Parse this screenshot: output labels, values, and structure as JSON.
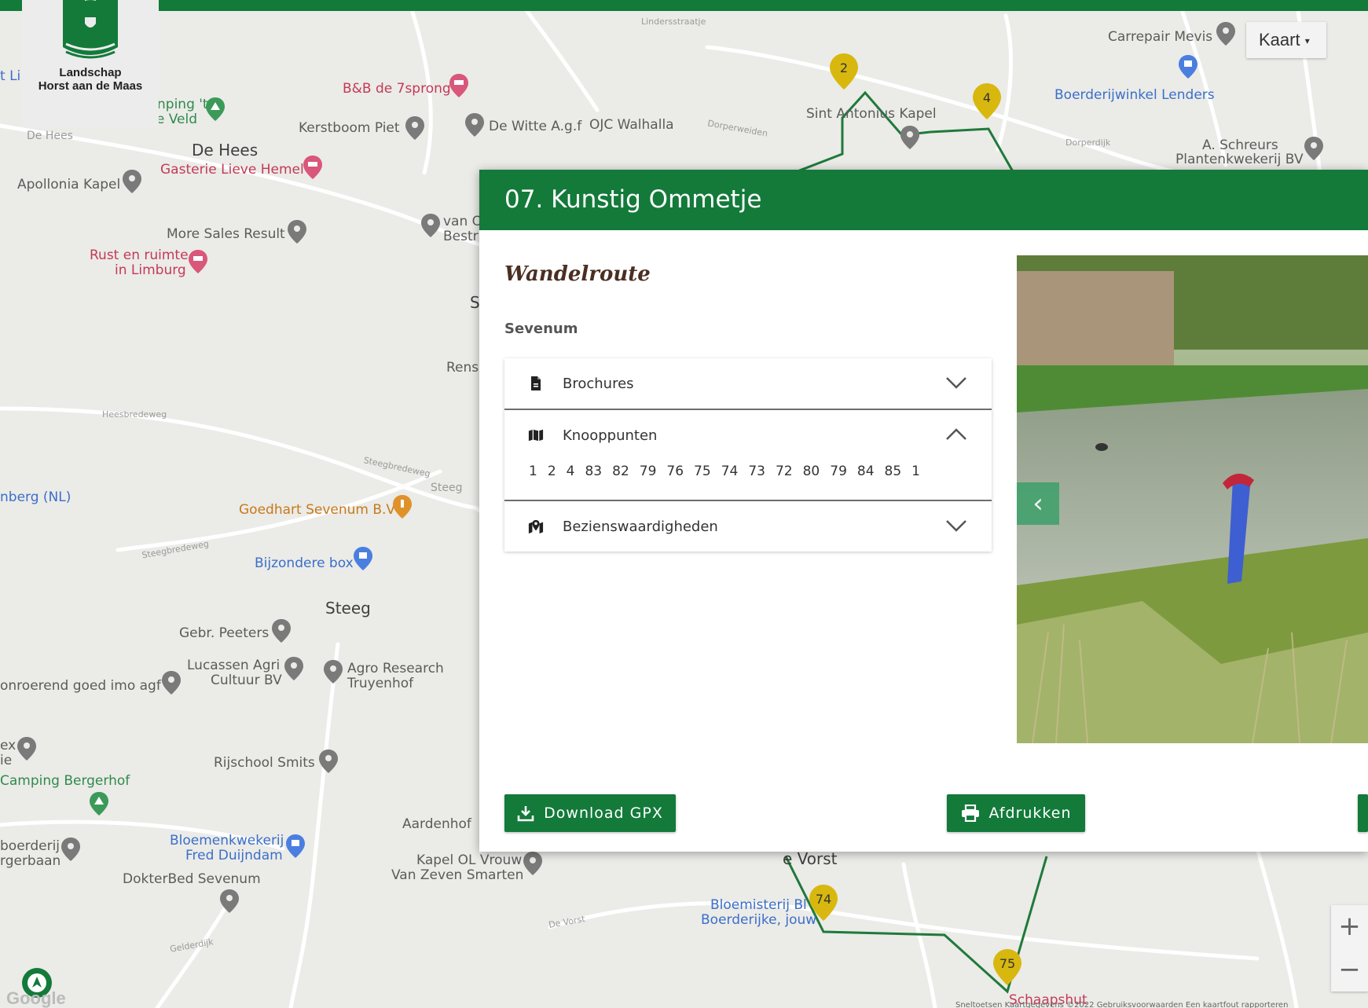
{
  "brand": {
    "line1": "Landschap",
    "line2": "Horst aan de Maas"
  },
  "map": {
    "type_label": "Kaart",
    "zoom_in": "+",
    "zoom_out": "−",
    "google": "Google",
    "footer": "Sneltoetsen   Kaartgegevens ©2022   Gebruiksvoorwaarden   Een kaartfout rapporteren",
    "places": [
      {
        "id": "bb7sprong",
        "text": "B&B de 7sprong"
      },
      {
        "id": "kerstboom",
        "text": "Kerstboom Piet"
      },
      {
        "id": "wittegf",
        "text": "De Witte A.g.f"
      },
      {
        "id": "walhalla",
        "text": "OJC Walhalla"
      },
      {
        "id": "sintantonius",
        "text": "Sint Antonius Kapel"
      },
      {
        "id": "carrepair",
        "text": "Carrepair Mevis"
      },
      {
        "id": "boerderijwinkel",
        "text": "Boerderijwinkel Lenders"
      },
      {
        "id": "schreurs1",
        "text": "A. Schreurs"
      },
      {
        "id": "schreurs2",
        "text": "Plantenkwekerij BV"
      },
      {
        "id": "dehees",
        "text": "De Hees"
      },
      {
        "id": "gasterie",
        "text": "Gasterie Lieve Hemel"
      },
      {
        "id": "apollonia",
        "text": "Apollonia Kapel"
      },
      {
        "id": "camping1",
        "text": "nping 't"
      },
      {
        "id": "camping2",
        "text": "se Veld"
      },
      {
        "id": "moresales",
        "text": "More Sales Result"
      },
      {
        "id": "rust1",
        "text": "Rust en ruimte"
      },
      {
        "id": "rust2",
        "text": "in Limburg"
      },
      {
        "id": "vano",
        "text": "van O"
      },
      {
        "id": "bestr",
        "text": "Bestr"
      },
      {
        "id": "rens",
        "text": "Rens"
      },
      {
        "id": "nberg",
        "text": "nberg (NL)"
      },
      {
        "id": "goedhart",
        "text": "Goedhart Sevenum B.V"
      },
      {
        "id": "bijzondere",
        "text": "Bijzondere box"
      },
      {
        "id": "steeg",
        "text": "Steeg"
      },
      {
        "id": "peeters",
        "text": "Gebr. Peeters"
      },
      {
        "id": "lucassen1",
        "text": "Lucassen Agri"
      },
      {
        "id": "lucassen2",
        "text": "Cultuur BV"
      },
      {
        "id": "agro1",
        "text": "Agro Research"
      },
      {
        "id": "agro2",
        "text": "Truyenhof"
      },
      {
        "id": "onroerend",
        "text": "onroerend goed imo agf"
      },
      {
        "id": "ex",
        "text": "ex"
      },
      {
        "id": "ie",
        "text": "ie"
      },
      {
        "id": "rijschool",
        "text": "Rijschool Smits"
      },
      {
        "id": "bergerhof",
        "text": "Camping Bergerhof"
      },
      {
        "id": "aardenhof",
        "text": "Aardenhof"
      },
      {
        "id": "boerderij1",
        "text": "boerderij"
      },
      {
        "id": "boerderij2",
        "text": "rgerbaan"
      },
      {
        "id": "bloemenk1",
        "text": "Bloemenkwekerij"
      },
      {
        "id": "bloemenk2",
        "text": "Fred Duijndam"
      },
      {
        "id": "kapel1",
        "text": "Kapel OL Vrouw"
      },
      {
        "id": "kapel2",
        "text": "Van Zeven Smarten"
      },
      {
        "id": "dokterbed",
        "text": "DokterBed Sevenum"
      },
      {
        "id": "devorst",
        "text": "e Vorst"
      },
      {
        "id": "bloemisterij1",
        "text": "Bloemisterij Bl"
      },
      {
        "id": "bloemisterij2",
        "text": "Boerderijke, jouw"
      },
      {
        "id": "schaapshut",
        "text": "Schaapshut"
      },
      {
        "id": "tlil",
        "text": "t Li"
      },
      {
        "id": "sletter",
        "text": "S"
      }
    ],
    "roads": [
      {
        "id": "r1",
        "text": "Heesbredeweg"
      },
      {
        "id": "r2",
        "text": "Steegbredeweg"
      },
      {
        "id": "r3",
        "text": "Steegbredeweg"
      },
      {
        "id": "r4",
        "text": "De Hees"
      },
      {
        "id": "r5",
        "text": "Dorperweiden"
      },
      {
        "id": "r6",
        "text": "Dorperdijk"
      },
      {
        "id": "r7",
        "text": "Steeg"
      },
      {
        "id": "r8",
        "text": "De Vorst"
      },
      {
        "id": "r9",
        "text": "Gelderdijk"
      },
      {
        "id": "r10",
        "text": "Lindersstraatje"
      }
    ],
    "markers": [
      "2",
      "4",
      "74",
      "75"
    ]
  },
  "panel": {
    "title": "07. Kunstig Ommetje",
    "route_type": "Wandelroute",
    "location": "Sevenum",
    "sections": [
      {
        "label": "Brochures",
        "icon": "document-icon",
        "expanded": false
      },
      {
        "label": "Knooppunten",
        "icon": "map-icon",
        "expanded": true
      },
      {
        "label": "Bezienswaardigheden",
        "icon": "map-marker-icon",
        "expanded": false
      }
    ],
    "knooppunten": [
      "1",
      "2",
      "4",
      "83",
      "82",
      "79",
      "76",
      "75",
      "74",
      "73",
      "72",
      "80",
      "79",
      "84",
      "85",
      "1"
    ],
    "prev_label": "‹",
    "buttons": {
      "download": "Download GPX",
      "print": "Afdrukken"
    }
  },
  "colors": {
    "brand_green": "#137a3a",
    "route_green": "#1f7a3a",
    "marker_yellow": "#d8b80f"
  }
}
